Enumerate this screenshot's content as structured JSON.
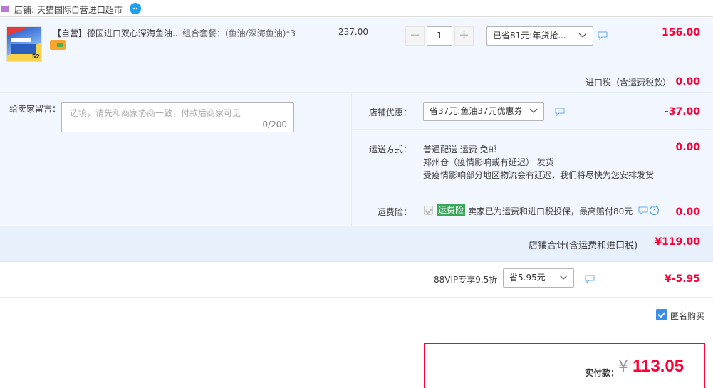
{
  "shop": {
    "label": "店铺: 天猫国际自营进口超市"
  },
  "product": {
    "title": "【自营】德国进口双心深海鱼油...",
    "spec": "组合套餐：(鱼油/深海鱼油)*3",
    "unit_price": "237.00",
    "quantity": "1",
    "qty_minus": "−",
    "qty_plus": "+",
    "promo_selected": "已省81元:年货抢...",
    "amount": "156.00",
    "thumb_badge": "52"
  },
  "tax": {
    "label": "进口税（含运费税款）",
    "amount": "0.00"
  },
  "message": {
    "label": "给卖家留言：",
    "placeholder": "选填，请先和商家协商一致，付款后商家可见",
    "count": "0/200"
  },
  "shop_discount": {
    "label": "店铺优惠：",
    "selected": "省37元:鱼油37元优惠券",
    "amount": "-37.00"
  },
  "shipping": {
    "label": "运送方式：",
    "line1": "普通配送 运费 免邮",
    "line2": "郑州仓（疫情影响或有延迟）  发货",
    "line3": "受疫情影响部分地区物流会有延迟，我们将尽快为您安排发货",
    "amount": "0.00"
  },
  "insurance": {
    "label": "运费险：",
    "tag": "运费险",
    "text": "卖家已为运费和进口税投保，最高赔付80元",
    "help": "?",
    "amount": "0.00"
  },
  "shop_total": {
    "label": "店铺合计(含运费和进口税)",
    "amount": "¥119.00"
  },
  "vip": {
    "label": "88VIP专享9.5折",
    "selected": "省5.95元",
    "amount": "¥-5.95"
  },
  "anonymous": {
    "label": "匿名购买",
    "checked": true
  },
  "payment": {
    "label": "实付款：",
    "currency": "¥",
    "amount": "113.05"
  },
  "colors": {
    "accent_red": "#ff0036",
    "panel_bg": "#f2f7ff",
    "checkbox_blue": "#3a8ee6",
    "insure_green": "#3aa65a"
  }
}
